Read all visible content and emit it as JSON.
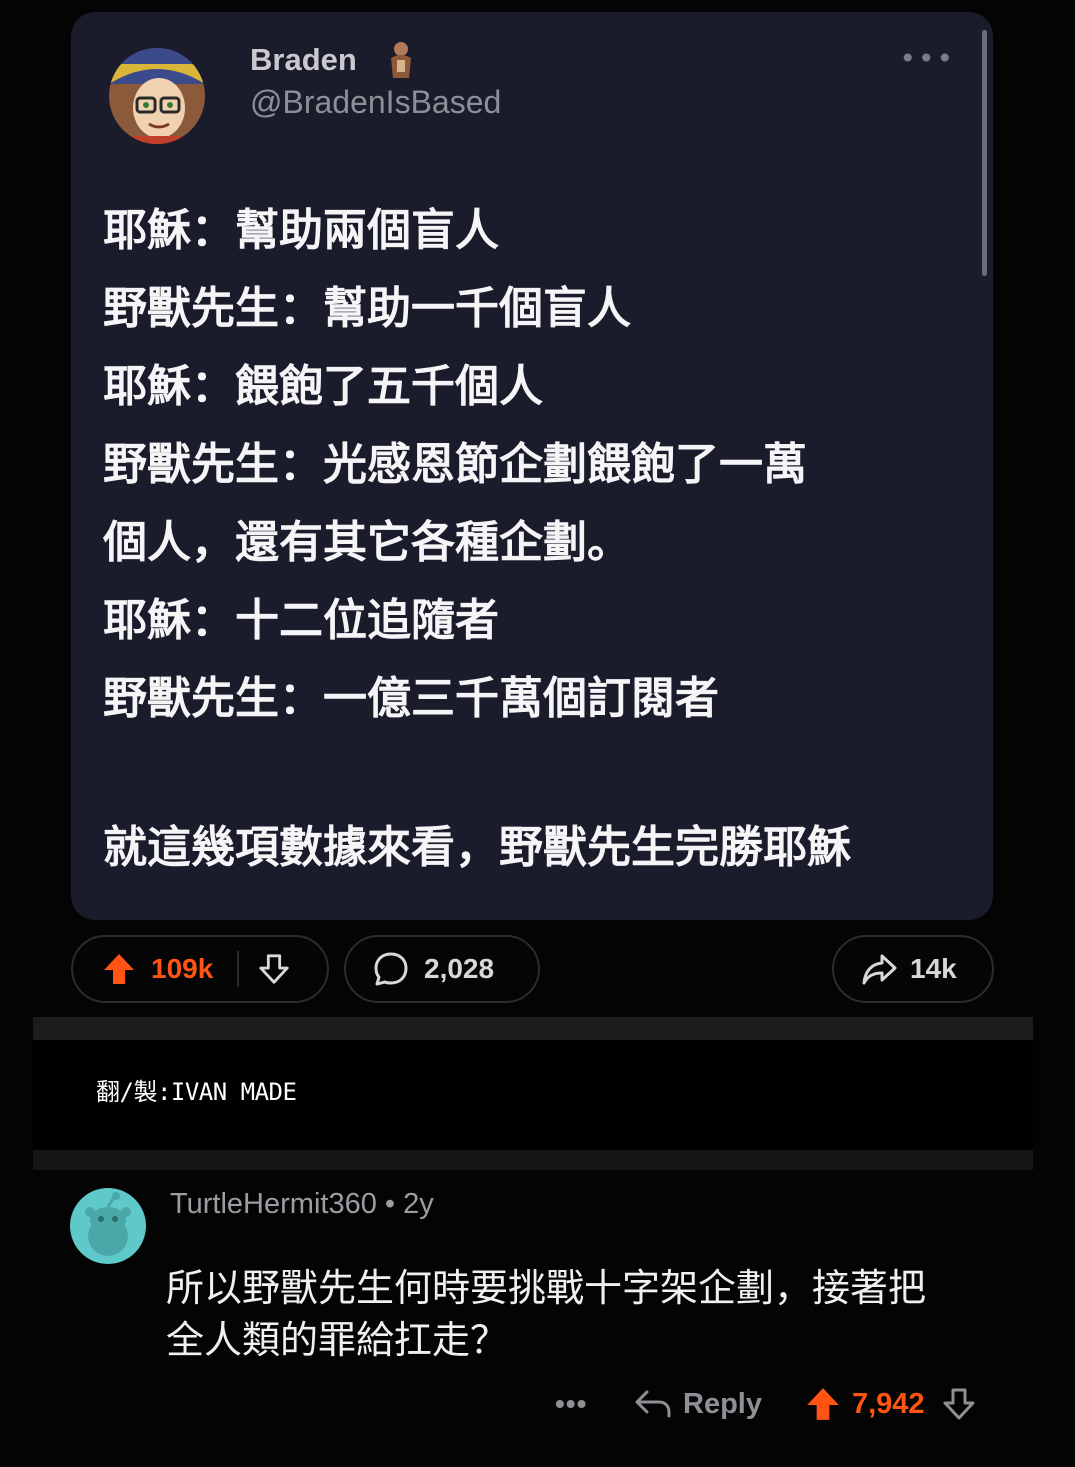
{
  "tweet": {
    "author_name": "Braden",
    "author_handle": "@BradenIsBased",
    "more_label": "•••",
    "lines": [
      "耶穌：幫助兩個盲人",
      "野獸先生：幫助一千個盲人",
      "耶穌：餵飽了五千個人",
      "野獸先生：光感恩節企劃餵飽了一萬",
      "個人，還有其它各種企劃。",
      "耶穌：十二位追隨者",
      "野獸先生：一億三千萬個訂閱者"
    ],
    "conclusion": "就這幾項數據來看，野獸先生完勝耶穌"
  },
  "post_actions": {
    "upvotes": "109k",
    "comments": "2,028",
    "shares": "14k"
  },
  "credit": "翻/製:IVAN MADE",
  "comment": {
    "author": "TurtleHermit360",
    "separator": "•",
    "age": "2y",
    "text_lines": [
      "所以野獸先生何時要挑戰十字架企劃，接著把",
      "全人類的罪給扛走？"
    ],
    "more_label": "•••",
    "reply_label": "Reply",
    "score": "7,942"
  },
  "colors": {
    "upvote_accent": "#ff5414",
    "card_background": "#1a1b2b",
    "avatar_background": "#5fc8c8"
  }
}
